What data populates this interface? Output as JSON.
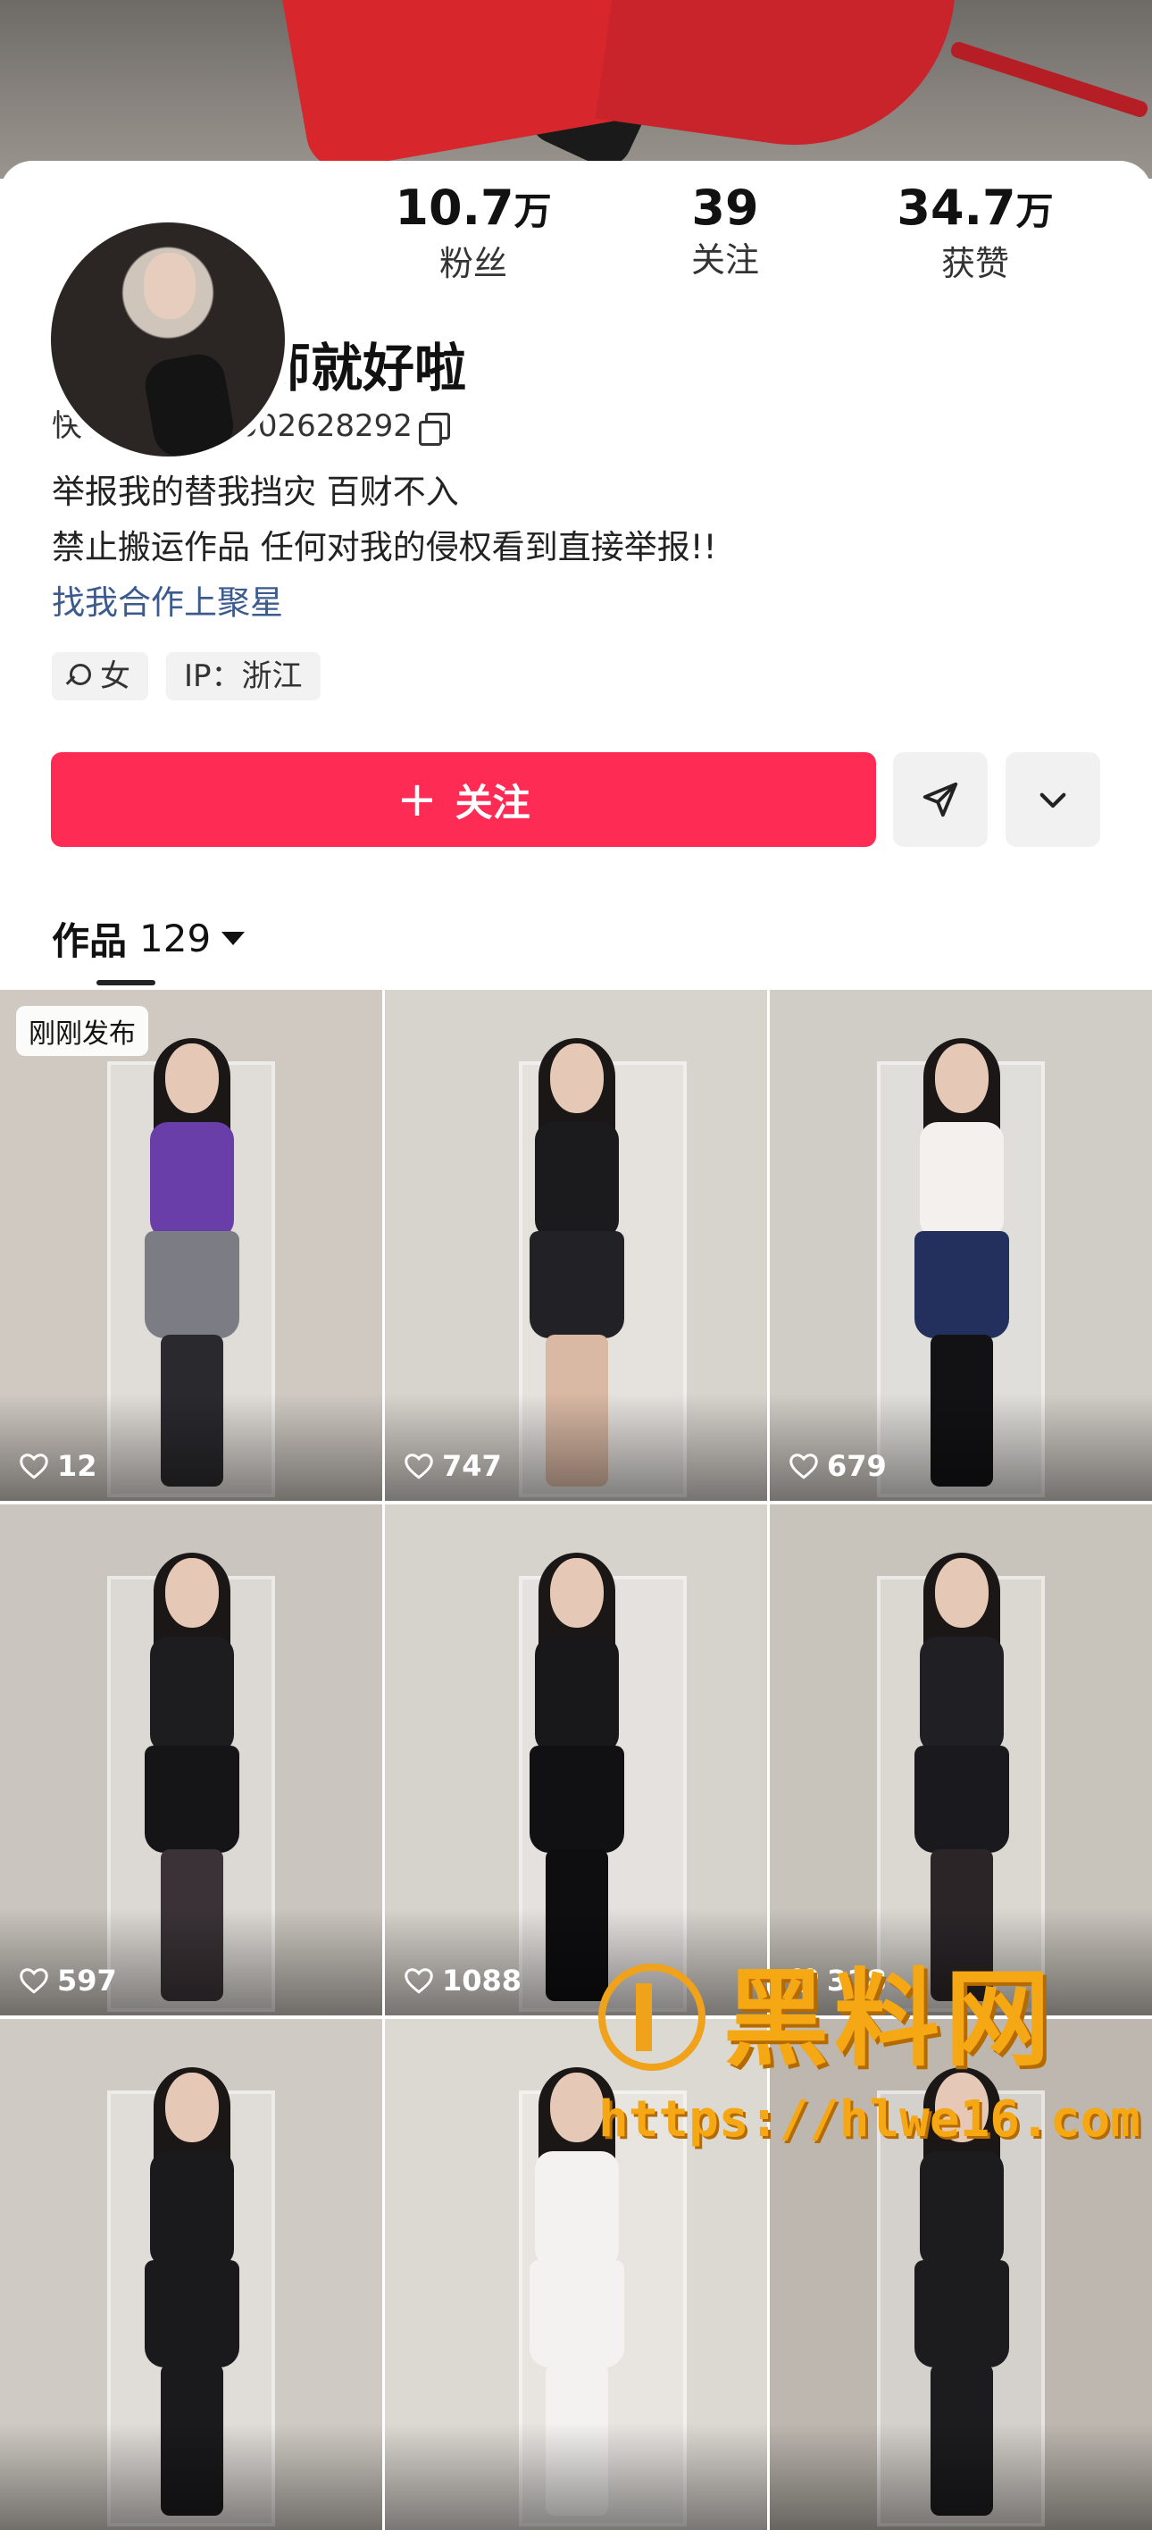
{
  "profile": {
    "followers_num": "10.7",
    "followers_unit": "万",
    "followers_label": "粉丝",
    "following_num": "39",
    "following_label": "关注",
    "likes_num": "34.7",
    "likes_unit": "万",
    "likes_label": "获赞",
    "name": "叫我肉老师就好啦",
    "kuaishou_id": "快手号: aa68002628292",
    "bio_line1": "举报我的替我挡灾 百财不入",
    "bio_line2": "禁止搬运作品 任何对我的侵权看到直接举报!!",
    "bio_link": "找我合作上聚星",
    "tag_gender": "女",
    "tag_ip": "IP：浙江"
  },
  "actions": {
    "follow_label": "关注",
    "follow_color": "#fe2c55"
  },
  "works": {
    "tab_label": "作品",
    "count": "129",
    "new_badge": "刚刚发布",
    "items": [
      {
        "likes": "12",
        "bg": "#cfc9c2",
        "top": "#6a3ea8",
        "bottom": "#7c7c85",
        "legs": "#2a2a2e"
      },
      {
        "likes": "747",
        "bg": "#d7d3cd",
        "top": "#1b1b1d",
        "bottom": "#222226",
        "legs": "#d9b8a4"
      },
      {
        "likes": "679",
        "bg": "#d0ccc6",
        "top": "#f3f0ee",
        "bottom": "#23305e",
        "legs": "#121214"
      },
      {
        "likes": "597",
        "bg": "#cac5be",
        "top": "#1d1d20",
        "bottom": "#151518",
        "legs": "#3a3236"
      },
      {
        "likes": "1088",
        "bg": "#d6d2cc",
        "top": "#18181a",
        "bottom": "#111113",
        "legs": "#0e0e10"
      },
      {
        "likes": "318",
        "bg": "#c8c3bb",
        "top": "#202024",
        "bottom": "#1a1a1e",
        "legs": "#2b2528"
      },
      {
        "likes": "",
        "bg": "#cfcac3",
        "top": "#1a1a1c",
        "bottom": "#1a1a1c",
        "legs": "#1a1a1c"
      },
      {
        "likes": "",
        "bg": "#dcd8d2",
        "top": "#f4f2f0",
        "bottom": "#f4f2f0",
        "legs": "#f4f2f0"
      },
      {
        "likes": "",
        "bg": "#bdb7af",
        "top": "#1c1c1e",
        "bottom": "#1c1c1e",
        "legs": "#1c1c1e"
      }
    ]
  },
  "watermark": {
    "text": "黑料网",
    "url": "https://hlwe16.com"
  }
}
